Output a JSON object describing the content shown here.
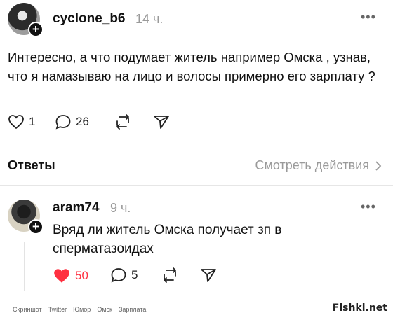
{
  "post": {
    "username": "cyclone_b6",
    "time": "14 ч.",
    "text": "Интересно, а что подумает житель например Омска , узнав,  что я намазываю на лицо и волосы примерно его зарплату ?",
    "likes": "1",
    "comments": "26"
  },
  "replies_header": {
    "label": "Ответы",
    "view_activity": "Смотреть действия"
  },
  "reply": {
    "username": "aram74",
    "time": "9 ч.",
    "text": "Вряд ли житель Омска получает зп в сперматазоидах",
    "likes": "50",
    "comments": "5"
  },
  "footer": {
    "links": [
      "Скриншот",
      "Twitter",
      "Юмор",
      "Омск",
      "Зарплата"
    ],
    "watermark": "Fishki.net"
  },
  "colors": {
    "like_active": "#ff3040",
    "muted": "#9a9a9a"
  }
}
